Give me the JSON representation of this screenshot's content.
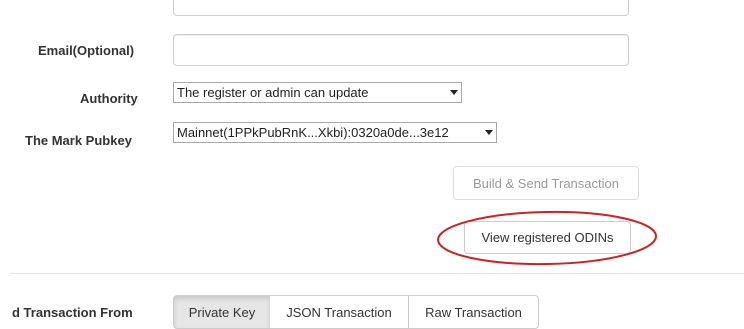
{
  "form": {
    "email_label": "Email(Optional)",
    "email_value": "",
    "authority_label": "Authority",
    "authority_selected": "The register or admin can update",
    "mark_pubkey_label": "The Mark Pubkey",
    "mark_pubkey_selected": "Mainnet(1PPkPubRnK...Xkbi):0320a0de...3e12"
  },
  "actions": {
    "build_send_label": "Build & Send Transaction",
    "view_registered_label": "View registered ODINs"
  },
  "send_from": {
    "label": "d Transaction From",
    "tabs": [
      "Private Key",
      "JSON Transaction",
      "Raw Transaction"
    ],
    "active_tab": "Private Key"
  },
  "annotation": {
    "highlight_color": "#cc2222"
  }
}
